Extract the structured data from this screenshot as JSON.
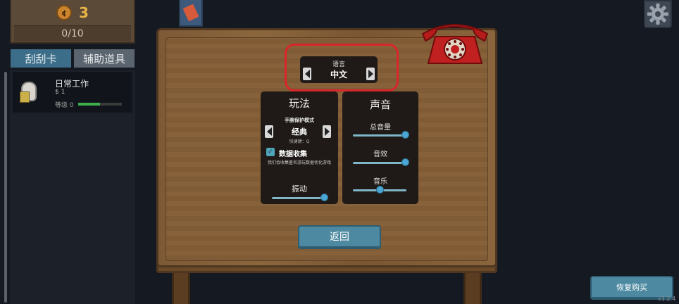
{
  "header": {
    "coin_count": "3",
    "coin_symbol": "¢",
    "progress": "0/10"
  },
  "tabs": [
    {
      "label": "刮刮卡",
      "active": true
    },
    {
      "label": "辅助道具",
      "active": false
    }
  ],
  "job_list": [
    {
      "title": "日常工作",
      "price": "$ 1",
      "level": "等级 0",
      "level_progress": 0.5
    }
  ],
  "settings": {
    "language": {
      "title": "语言",
      "value": "中文"
    },
    "gameplay": {
      "title": "玩法",
      "wrist_mode_label": "手腕保护模式",
      "wrist_mode_value": "经典",
      "shortcut": "快捷键：Q",
      "data_collection_label": "数据收集",
      "data_collection_checked": true,
      "data_collection_desc": "我们会收集匿名游玩数据优化游戏",
      "vibration_label": "振动",
      "vibration_level": 0.98
    },
    "sound": {
      "title": "声音",
      "master_label": "总音量",
      "master_level": 0.98,
      "sfx_label": "音效",
      "sfx_level": 0.98,
      "music_label": "音乐",
      "music_level": 0.5
    },
    "back_label": "返回"
  },
  "restore_label": "恢复购买",
  "version": "v1.2.4",
  "colors": {
    "highlight": "#d9262a",
    "accent": "#4d8aa1",
    "slider_knob": "#4aa6d4",
    "level_bar": "#3fae4c",
    "coin_text": "#e7b548"
  },
  "icons": {
    "coin": "coin-icon",
    "ticket": "ticket-icon",
    "gear": "gear-icon",
    "phone": "telephone-icon"
  }
}
